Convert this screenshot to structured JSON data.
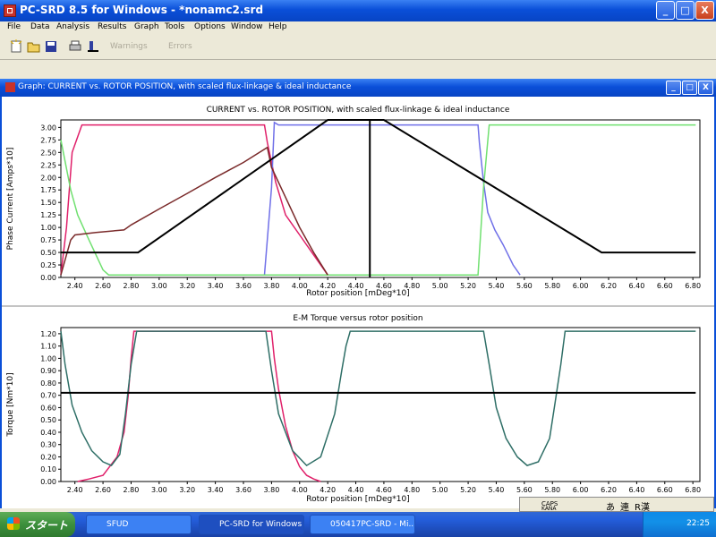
{
  "window": {
    "title": "PC-SRD 8.5 for Windows - *nonamc2.srd",
    "buttons": {
      "minimize": "_",
      "maximize": "□",
      "close": "X"
    }
  },
  "menu": [
    "File",
    "Data",
    "Analysis",
    "Results",
    "Graph",
    "Tools",
    "Options",
    "Window",
    "Help"
  ],
  "toolbar": {
    "icons": [
      "new-icon",
      "open-icon",
      "save-icon",
      "print-icon",
      "tools-icon"
    ],
    "warnings_label": "Warnings",
    "errors_label": "Errors"
  },
  "graph_window": {
    "title": "Graph: CURRENT vs. ROTOR POSITION, with scaled flux-linkage & ideal inductance"
  },
  "colors": {
    "phaseA": "#e0206a",
    "phaseB": "#7070e8",
    "phaseC": "#70e070",
    "flux": "#7a2a2a",
    "inductance": "#000000",
    "torque": "#2e6e66",
    "titlebar": "#0a4fd8"
  },
  "chart_data": [
    {
      "type": "line",
      "title": "CURRENT vs. ROTOR POSITION, with scaled flux-linkage & ideal inductance",
      "xlabel": "Rotor position [mDeg*10]",
      "ylabel": "Phase Current [Amps*10]",
      "xlim": [
        2.3,
        6.85
      ],
      "ylim": [
        0,
        3.15
      ],
      "x_ticks": [
        "2.40",
        "2.60",
        "2.80",
        "3.00",
        "3.20",
        "3.40",
        "3.60",
        "3.80",
        "4.00",
        "4.20",
        "4.40",
        "4.60",
        "4.80",
        "5.00",
        "5.20",
        "5.40",
        "5.60",
        "5.80",
        "6.00",
        "6.20",
        "6.40",
        "6.60",
        "6.80"
      ],
      "y_ticks": [
        "0.00",
        "0.25",
        "0.50",
        "0.75",
        "1.00",
        "1.25",
        "1.50",
        "1.75",
        "2.00",
        "2.25",
        "2.50",
        "2.75",
        "3.00"
      ],
      "marker_x": 4.5,
      "series": [
        {
          "color": "#e0206a",
          "x": [
            2.3,
            2.34,
            2.38,
            2.45,
            3.75,
            3.77,
            3.83,
            3.9,
            4.0,
            4.1,
            4.2
          ],
          "y": [
            0.05,
            1.0,
            2.5,
            3.05,
            3.05,
            2.7,
            1.9,
            1.25,
            0.85,
            0.45,
            0.05
          ]
        },
        {
          "color": "#7070e8",
          "x": [
            3.75,
            3.8,
            3.82,
            3.85,
            5.27,
            5.28,
            5.31,
            5.34,
            5.39,
            5.45,
            5.52,
            5.57
          ],
          "y": [
            0.05,
            1.8,
            3.1,
            3.05,
            3.05,
            2.7,
            1.9,
            1.3,
            0.95,
            0.65,
            0.25,
            0.05
          ]
        },
        {
          "color": "#70e070",
          "x": [
            2.3,
            2.37,
            2.42,
            2.5,
            2.6,
            2.64,
            5.27,
            5.31,
            5.35,
            6.82
          ],
          "y": [
            2.75,
            1.75,
            1.25,
            0.75,
            0.15,
            0.05,
            0.05,
            1.8,
            3.05,
            3.05
          ]
        },
        {
          "color": "#7a2a2a",
          "x": [
            2.3,
            2.37,
            2.4,
            2.55,
            2.75,
            2.8,
            3.0,
            3.2,
            3.4,
            3.6,
            3.77,
            3.8,
            3.9,
            4.0,
            4.1,
            4.2
          ],
          "y": [
            0.05,
            0.75,
            0.85,
            0.9,
            0.95,
            1.05,
            1.37,
            1.68,
            2.0,
            2.3,
            2.6,
            2.2,
            1.6,
            1.0,
            0.5,
            0.05
          ]
        },
        {
          "color": "#000000",
          "x": [
            2.3,
            2.85,
            4.2,
            4.6,
            6.15,
            6.82
          ],
          "y": [
            0.5,
            0.5,
            3.15,
            3.15,
            0.5,
            0.5
          ]
        }
      ]
    },
    {
      "type": "line",
      "title": "E-M Torque versus rotor position",
      "xlabel": "Rotor position [mDeg*10]",
      "ylabel": "Torque [Nm*10]",
      "xlim": [
        2.3,
        6.85
      ],
      "ylim": [
        0,
        1.25
      ],
      "x_ticks": [
        "2.40",
        "2.60",
        "2.80",
        "3.00",
        "3.20",
        "3.40",
        "3.60",
        "3.80",
        "4.00",
        "4.20",
        "4.40",
        "4.60",
        "4.80",
        "5.00",
        "5.20",
        "5.40",
        "5.60",
        "5.80",
        "6.00",
        "6.20",
        "6.40",
        "6.60",
        "6.80"
      ],
      "y_ticks": [
        "0.00",
        "0.10",
        "0.20",
        "0.30",
        "0.40",
        "0.50",
        "0.60",
        "0.70",
        "0.80",
        "0.90",
        "1.00",
        "1.10",
        "1.20"
      ],
      "average_torque": 0.72,
      "series": [
        {
          "color": "#e0206a",
          "x": [
            2.42,
            2.5,
            2.6,
            2.7,
            2.75,
            2.78,
            2.8,
            2.82,
            3.8,
            3.82,
            3.85,
            3.9,
            3.95,
            4.0,
            4.05,
            4.1,
            4.15
          ],
          "y": [
            0.0,
            0.02,
            0.05,
            0.2,
            0.4,
            0.7,
            1.0,
            1.22,
            1.22,
            1.0,
            0.75,
            0.45,
            0.25,
            0.12,
            0.05,
            0.02,
            0.0
          ]
        },
        {
          "color": "#2e6e66",
          "x": [
            2.3,
            2.33,
            2.38,
            2.45,
            2.52,
            2.6,
            2.66,
            2.72,
            2.76,
            2.8,
            2.84,
            3.76,
            3.8,
            3.85,
            3.95,
            4.05,
            4.15,
            4.25,
            4.3,
            4.33,
            4.36,
            5.31,
            5.35,
            5.4,
            5.47,
            5.55,
            5.62,
            5.7,
            5.78,
            5.82,
            5.86,
            5.89,
            6.82
          ],
          "y": [
            1.22,
            0.95,
            0.62,
            0.4,
            0.25,
            0.16,
            0.13,
            0.22,
            0.55,
            0.95,
            1.22,
            1.22,
            0.9,
            0.55,
            0.25,
            0.13,
            0.2,
            0.55,
            0.9,
            1.1,
            1.22,
            1.22,
            0.95,
            0.6,
            0.35,
            0.2,
            0.13,
            0.16,
            0.35,
            0.65,
            0.95,
            1.22,
            1.22
          ]
        },
        {
          "color": "#000000",
          "x": [
            2.3,
            6.82
          ],
          "y": [
            0.72,
            0.72
          ]
        }
      ]
    }
  ],
  "taskbar": {
    "start_label": "スタート",
    "items": [
      "SFUD",
      "PC-SRD for Windows",
      "050417PC-SRD - Mi..."
    ],
    "clock": "22:25"
  },
  "ime": {
    "caps": "CAPS",
    "kana": "KANA",
    "mode1": "あ",
    "mode2": "連",
    "mode3": "R漢"
  }
}
